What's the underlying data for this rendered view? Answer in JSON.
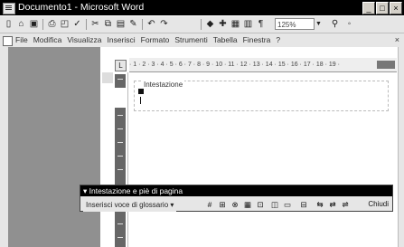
{
  "window": {
    "title": "Documento1 - Microsoft Word",
    "buttons": {
      "minimize": "_",
      "maximize": "□",
      "close": "×"
    }
  },
  "toolbar": {
    "zoom": "125%",
    "icons": [
      "new-document-icon",
      "open-icon",
      "save-icon",
      "print-icon",
      "print-preview-icon",
      "spelling-icon",
      "cut-icon",
      "copy-icon",
      "paste-icon",
      "format-painter-icon",
      "undo-icon",
      "redo-icon",
      "hyperlink-icon",
      "tables-borders-icon",
      "insert-table-icon",
      "columns-icon",
      "drawing-icon",
      "show-hide-icon"
    ]
  },
  "menubar": {
    "items": [
      "File",
      "Modifica",
      "Visualizza",
      "Inserisci",
      "Formato",
      "Strumenti",
      "Tabella",
      "Finestra",
      "?"
    ],
    "close_label": "×"
  },
  "ruler": {
    "text": "· 1 · 2 · 3 · 4 · 5 · 6 · 7 · 8 · 9 · 10 · 11 · 12 · 13 · 14 · 15 · 16 · 17 · 18 · 19 ·",
    "corner": "L"
  },
  "document": {
    "header_label": "Intestazione"
  },
  "hf_toolbar": {
    "title": "▾ Intestazione e piè di pagina",
    "insert_label": "Inserisci voce di glossario ▾",
    "close_label": "Chiudi",
    "buttons": [
      "#",
      "⊞",
      "⊗",
      "▦",
      "⊡",
      "◫",
      "▭",
      "⊟",
      "⇆",
      "⇄",
      "⇌"
    ]
  }
}
